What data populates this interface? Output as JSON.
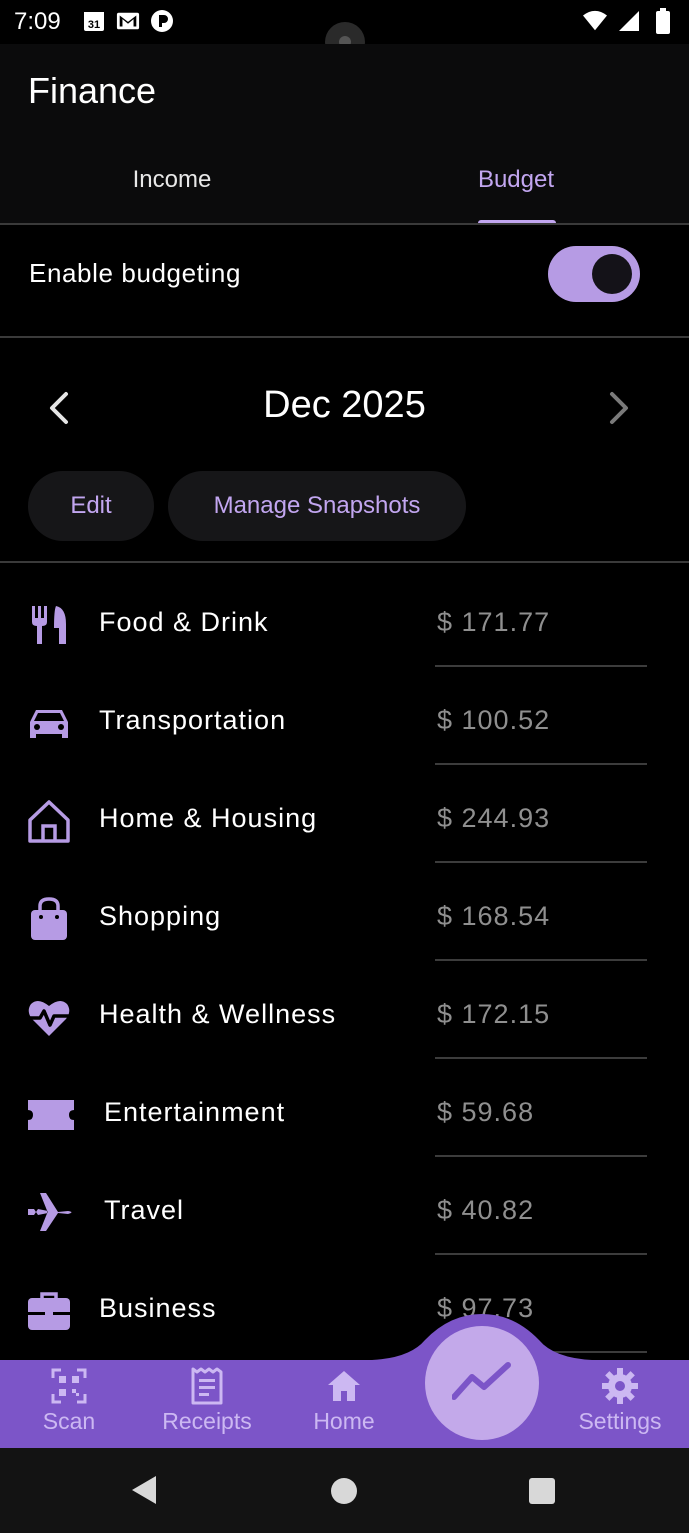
{
  "status_bar": {
    "time": "7:09",
    "calendar_day": "31",
    "icons_left": [
      "calendar-icon",
      "gmail-icon",
      "app-notification-icon"
    ],
    "icons_right": [
      "wifi-icon",
      "signal-icon",
      "battery-icon"
    ]
  },
  "app": {
    "title": "Finance",
    "tabs": [
      {
        "label": "Income",
        "selected": false
      },
      {
        "label": "Budget",
        "selected": true
      }
    ]
  },
  "budget": {
    "enable_label": "Enable budgeting",
    "enabled": true,
    "month": "Dec 2025",
    "edit_label": "Edit",
    "snapshots_label": "Manage Snapshots",
    "categories": [
      {
        "icon": "fork-knife-icon",
        "label": "Food & Drink",
        "amount": "$ 171.77"
      },
      {
        "icon": "car-icon",
        "label": "Transportation",
        "amount": "$ 100.52"
      },
      {
        "icon": "house-icon",
        "label": "Home & Housing",
        "amount": "$ 244.93"
      },
      {
        "icon": "shopping-bag-icon",
        "label": "Shopping",
        "amount": "$ 168.54"
      },
      {
        "icon": "heart-pulse-icon",
        "label": "Health & Wellness",
        "amount": "$ 172.15"
      },
      {
        "icon": "ticket-icon",
        "label": "Entertainment",
        "amount": "$ 59.68"
      },
      {
        "icon": "airplane-icon",
        "label": "Travel",
        "amount": "$ 40.82"
      },
      {
        "icon": "briefcase-icon",
        "label": "Business",
        "amount": "$ 97.73"
      }
    ]
  },
  "bottom_nav": {
    "items": [
      {
        "label": "Scan",
        "icon": "qr-code-icon"
      },
      {
        "label": "Receipts",
        "icon": "receipt-icon"
      },
      {
        "label": "Home",
        "icon": "home-icon"
      },
      {
        "label": "Settings",
        "icon": "gear-icon"
      }
    ],
    "fab_icon": "trending-chart-icon"
  },
  "colors": {
    "accent": "#c2a6f0",
    "nav_bar": "#7c55c8",
    "background": "#000000"
  }
}
